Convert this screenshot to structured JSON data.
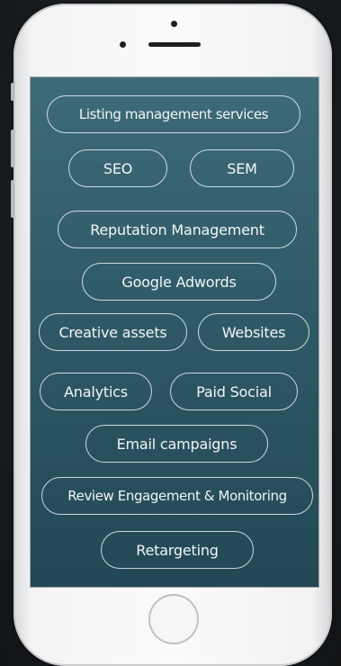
{
  "services": [
    "Listing management services",
    "SEO",
    "SEM",
    "Reputation Management",
    "Google Adwords",
    "Creative assets",
    "Websites",
    "Analytics",
    "Paid Social",
    "Email campaigns",
    "Review Engagement & Monitoring",
    "Retargeting"
  ],
  "colors": {
    "screen": "#2f5a67",
    "phone_body": "#f4f4f5",
    "pill_border": "#ebf0f2",
    "background": "#1c2023"
  },
  "icons": {
    "home_button": "circle-icon",
    "camera": "dot-icon"
  }
}
